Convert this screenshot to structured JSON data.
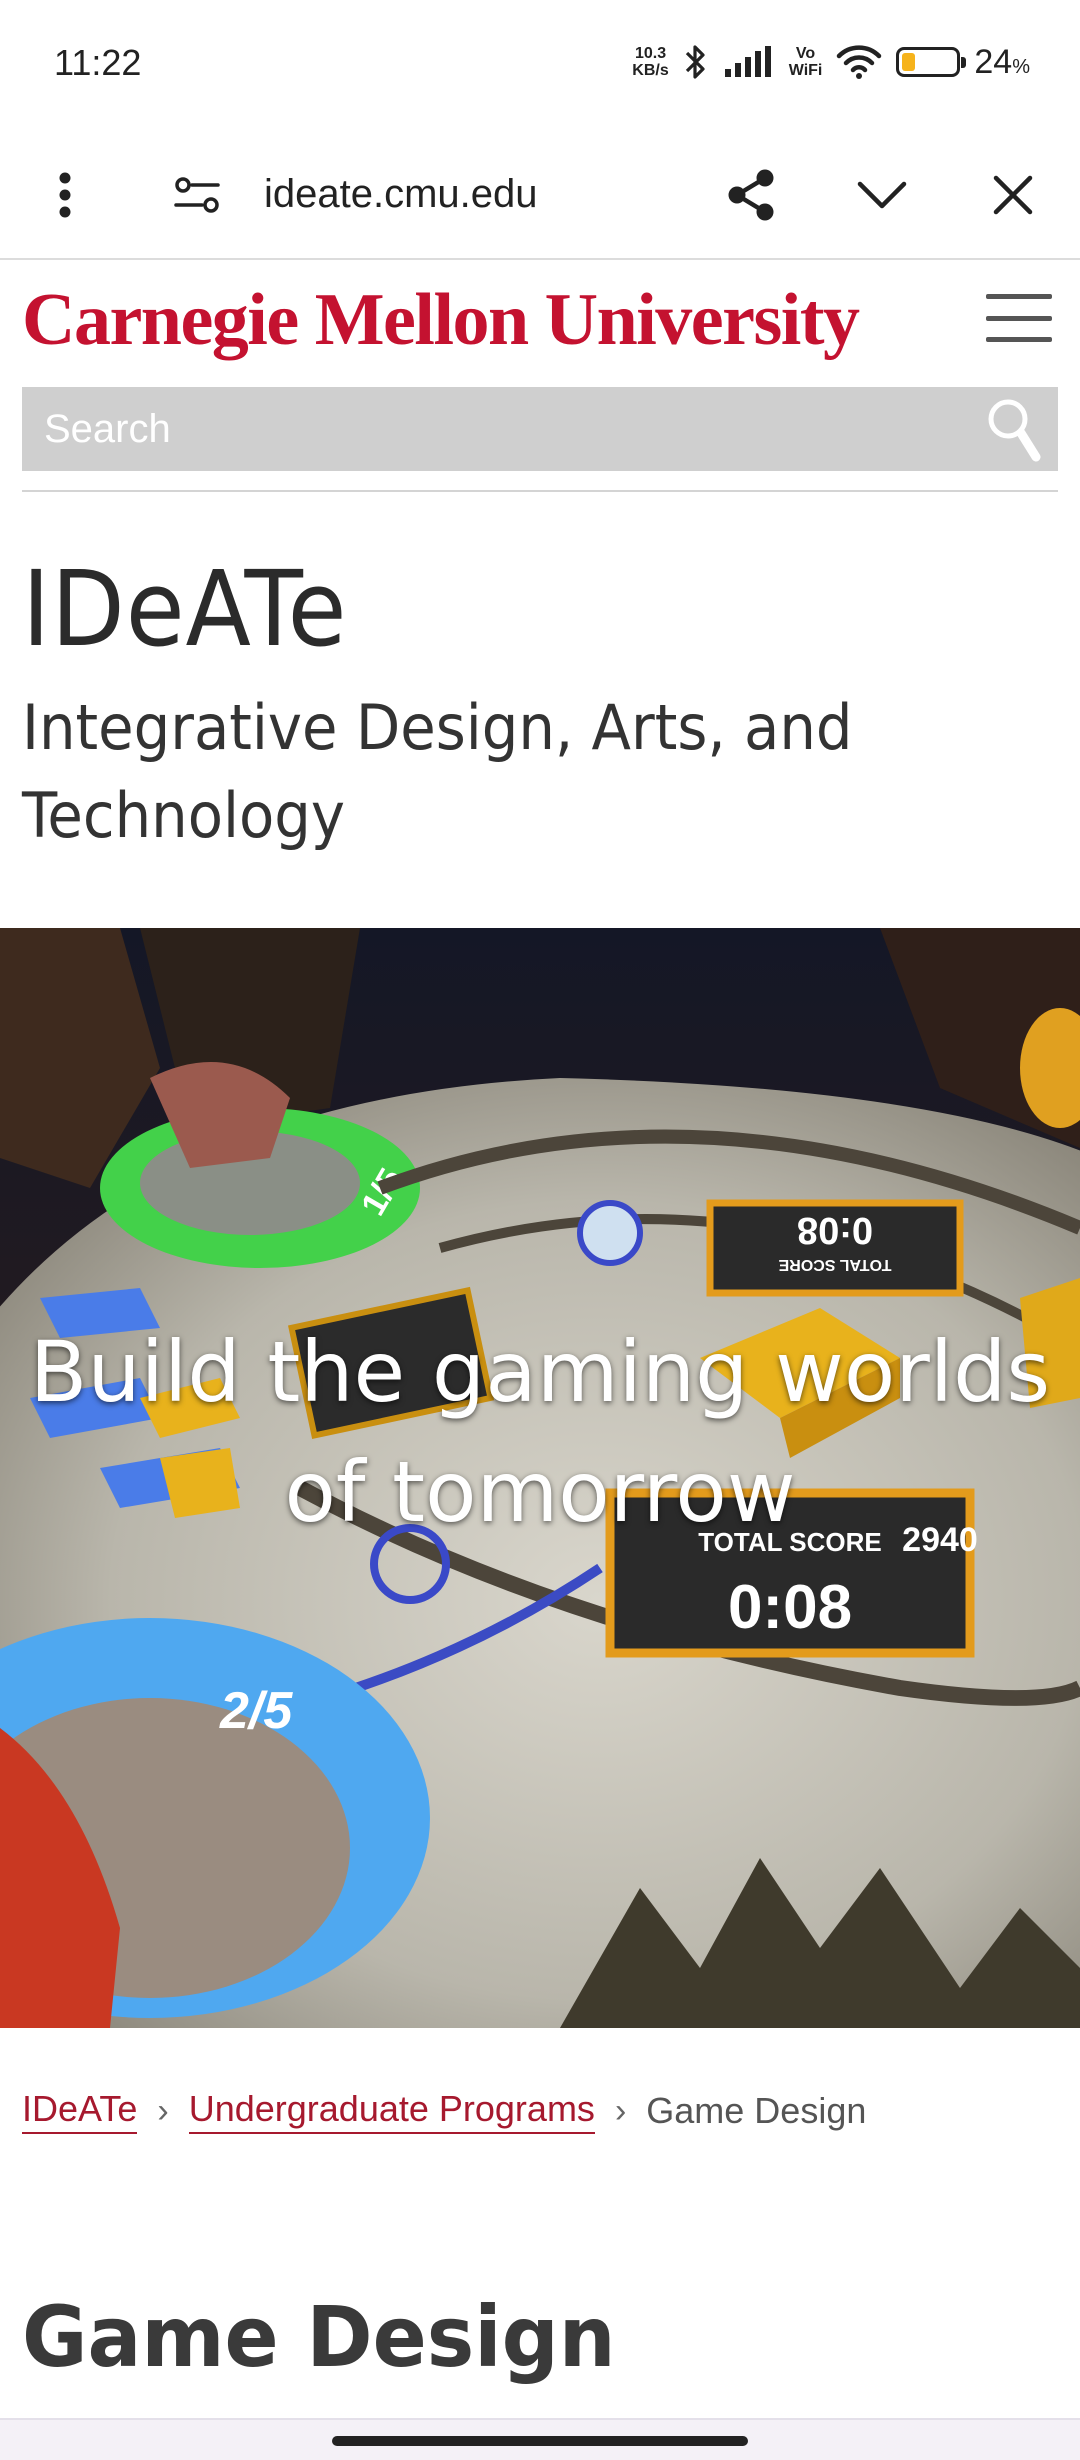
{
  "status_bar": {
    "time": "11:22",
    "net_speed_value": "10.3",
    "net_speed_unit": "KB/s",
    "volte_top": "Vo",
    "volte_bottom": "WiFi",
    "battery_percent": "24",
    "battery_percent_sign": "%",
    "battery_level": 0.24,
    "battery_color": "#f6b31b"
  },
  "browser": {
    "url": "ideate.cmu.edu",
    "icons": [
      "more-vert-icon",
      "site-settings-icon",
      "share-icon",
      "chevron-down-icon",
      "close-icon"
    ]
  },
  "header": {
    "logo_text": "Carnegie Mellon University",
    "brand_color": "#c41230",
    "search_placeholder": "Search"
  },
  "site": {
    "title": "IDeATe",
    "subtitle": "Integrative Design, Arts, and Technology"
  },
  "hero": {
    "caption": "Build the gaming worlds of tomorrow",
    "overlay_texts": {
      "total_score_label": "TOTAL SCORE",
      "score": "2940",
      "timer": "0:08",
      "counter_bottom": "2/5",
      "counter_top": "1/5"
    }
  },
  "breadcrumb": {
    "items": [
      {
        "label": "IDeATe",
        "link": true
      },
      {
        "label": "Undergraduate Programs",
        "link": true
      },
      {
        "label": "Game Design",
        "link": false
      }
    ],
    "separator": "›"
  },
  "page": {
    "heading": "Game Design"
  }
}
